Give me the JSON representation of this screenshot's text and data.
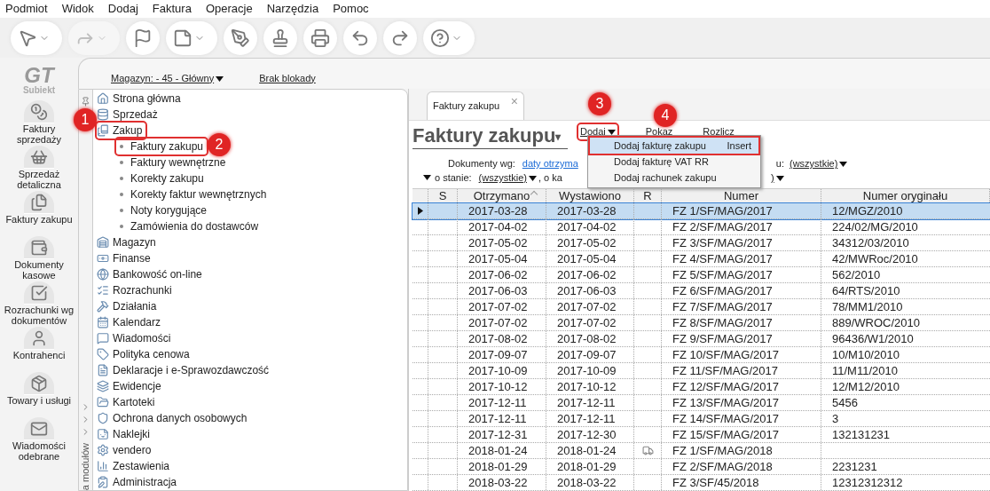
{
  "menu_bar": [
    "Podmiot",
    "Widok",
    "Dodaj",
    "Faktura",
    "Operacje",
    "Narzędzia",
    "Pomoc"
  ],
  "toolbar": [
    {
      "dropdown": true,
      "disabled": false
    },
    {
      "dropdown": true,
      "disabled": true
    },
    {
      "dropdown": false,
      "disabled": false
    },
    {
      "dropdown": true,
      "disabled": false
    },
    {
      "dropdown": false,
      "disabled": false
    },
    {
      "dropdown": false,
      "disabled": false
    },
    {
      "dropdown": false,
      "disabled": false
    },
    {
      "dropdown": false,
      "disabled": false
    },
    {
      "dropdown": false,
      "disabled": false
    },
    {
      "dropdown": true,
      "disabled": false
    }
  ],
  "logo": {
    "mark": "GT",
    "name": "Subiekt"
  },
  "rail": [
    "Faktury sprzedaży",
    "Sprzedaż detaliczna",
    "Faktury zakupu",
    "Dokumenty kasowe",
    "Rozrachunki wg dokumentów",
    "Kontrahenci",
    "Towary i usługi",
    "Wiadomości odebrane"
  ],
  "top_links": [
    {
      "text": "Magazyn: - 45 - Główny",
      "dropdown": true
    },
    {
      "text": "Brak blokady",
      "dropdown": false
    }
  ],
  "nav_tree": [
    {
      "label": "Strona główna",
      "highlighted": false
    },
    {
      "label": "Sprzedaż",
      "highlighted": false
    },
    {
      "label": "Zakup",
      "highlighted": true,
      "children": [
        {
          "label": "Faktury zakupu",
          "highlighted": true
        },
        {
          "label": "Faktury wewnętrzne",
          "highlighted": false
        },
        {
          "label": "Korekty zakupu",
          "highlighted": false
        },
        {
          "label": "Korekty faktur wewnętrznych",
          "highlighted": false
        },
        {
          "label": "Noty korygujące",
          "highlighted": false
        },
        {
          "label": "Zamówienia do dostawców",
          "highlighted": false
        }
      ]
    },
    {
      "label": "Magazyn",
      "highlighted": false
    },
    {
      "label": "Finanse",
      "highlighted": false
    },
    {
      "label": "Bankowość on-line",
      "highlighted": false
    },
    {
      "label": "Rozrachunki",
      "highlighted": false
    },
    {
      "label": "Działania",
      "highlighted": false
    },
    {
      "label": "Kalendarz",
      "highlighted": false
    },
    {
      "label": "Wiadomości",
      "highlighted": false
    },
    {
      "label": "Polityka cenowa",
      "highlighted": false
    },
    {
      "label": "Deklaracje i e-Sprawozdawczość",
      "highlighted": false
    },
    {
      "label": "Ewidencje",
      "highlighted": false
    },
    {
      "label": "Kartoteki",
      "highlighted": false
    },
    {
      "label": "Ochrona danych osobowych",
      "highlighted": false
    },
    {
      "label": "Naklejki",
      "highlighted": false
    },
    {
      "label": "vendero",
      "highlighted": false
    },
    {
      "label": "Zestawienia",
      "highlighted": false
    },
    {
      "label": "Administracja",
      "highlighted": false
    }
  ],
  "nav_side_label": "a modułów",
  "tab": {
    "label": "Faktury zakupu",
    "close": "×"
  },
  "page_title": "Faktury zakupu",
  "page_title_caret": "▾",
  "actions": [
    {
      "text": "Dodaj",
      "dropdown": true,
      "highlighted": true
    },
    {
      "text": "Pokaz",
      "dropdown": false,
      "highlighted": false
    },
    {
      "text": "Rozlicz",
      "dropdown": false,
      "highlighted": false
    }
  ],
  "filters": {
    "row1_label": "Dokumenty wg:",
    "row1_link": "daty otrzyma",
    "row1_tail_label": "u:",
    "row1_tail_value": "(wszystkie)",
    "row2_label": "o stanie:",
    "row2_value": "(wszystkie)",
    "row2_mid": ", o ka",
    "row2_tail": ")"
  },
  "dropdown_menu": [
    {
      "label": "Dodaj fakturę zakupu",
      "shortcut": "Insert",
      "selected": true,
      "highlighted": true
    },
    {
      "label": "Dodaj fakturę VAT RR",
      "selected": false,
      "highlighted": false
    },
    {
      "label": "Dodaj rachunek zakupu",
      "selected": false,
      "highlighted": false
    }
  ],
  "table": {
    "columns": [
      {
        "label": "S",
        "sorted": false
      },
      {
        "label": "Otrzymano",
        "sorted": true
      },
      {
        "label": "Wystawiono",
        "sorted": false
      },
      {
        "label": "R",
        "sorted": false
      },
      {
        "label": "Numer",
        "sorted": false
      },
      {
        "label": "Numer oryginału",
        "sorted": false
      }
    ],
    "rows": [
      {
        "received": "2017-03-28",
        "issued": "2017-03-28",
        "r_icon": false,
        "number": "FZ 1/SF/MAG/2017",
        "original": "12/MGZ/2010",
        "selected": true
      },
      {
        "received": "2017-04-02",
        "issued": "2017-04-02",
        "r_icon": false,
        "number": "FZ 2/SF/MAG/2017",
        "original": "224/02/MG/2010",
        "selected": false
      },
      {
        "received": "2017-05-02",
        "issued": "2017-05-02",
        "r_icon": false,
        "number": "FZ 3/SF/MAG/2017",
        "original": "34312/03/2010",
        "selected": false
      },
      {
        "received": "2017-05-04",
        "issued": "2017-05-04",
        "r_icon": false,
        "number": "FZ 4/SF/MAG/2017",
        "original": "42/MWRoc/2010",
        "selected": false
      },
      {
        "received": "2017-06-02",
        "issued": "2017-06-02",
        "r_icon": false,
        "number": "FZ 5/SF/MAG/2017",
        "original": "562/2010",
        "selected": false
      },
      {
        "received": "2017-06-03",
        "issued": "2017-06-03",
        "r_icon": false,
        "number": "FZ 6/SF/MAG/2017",
        "original": "64/RTS/2010",
        "selected": false
      },
      {
        "received": "2017-07-02",
        "issued": "2017-07-02",
        "r_icon": false,
        "number": "FZ 7/SF/MAG/2017",
        "original": "78/MM1/2010",
        "selected": false
      },
      {
        "received": "2017-07-02",
        "issued": "2017-07-02",
        "r_icon": false,
        "number": "FZ 8/SF/MAG/2017",
        "original": "889/WROC/2010",
        "selected": false
      },
      {
        "received": "2017-08-02",
        "issued": "2017-08-02",
        "r_icon": false,
        "number": "FZ 9/SF/MAG/2017",
        "original": "96436/W1/2010",
        "selected": false
      },
      {
        "received": "2017-09-07",
        "issued": "2017-09-07",
        "r_icon": false,
        "number": "FZ 10/SF/MAG/2017",
        "original": "10/M10/2010",
        "selected": false
      },
      {
        "received": "2017-10-09",
        "issued": "2017-10-09",
        "r_icon": false,
        "number": "FZ 11/SF/MAG/2017",
        "original": "11/M11/2010",
        "selected": false
      },
      {
        "received": "2017-10-12",
        "issued": "2017-10-12",
        "r_icon": false,
        "number": "FZ 12/SF/MAG/2017",
        "original": "12/M12/2010",
        "selected": false
      },
      {
        "received": "2017-12-11",
        "issued": "2017-12-11",
        "r_icon": false,
        "number": "FZ 13/SF/MAG/2017",
        "original": "5456",
        "selected": false
      },
      {
        "received": "2017-12-11",
        "issued": "2017-12-11",
        "r_icon": false,
        "number": "FZ 14/SF/MAG/2017",
        "original": "3",
        "selected": false
      },
      {
        "received": "2017-12-31",
        "issued": "2017-12-30",
        "r_icon": false,
        "number": "FZ 15/SF/MAG/2017",
        "original": "132131231",
        "selected": false
      },
      {
        "received": "2018-01-24",
        "issued": "2018-01-24",
        "r_icon": true,
        "number": "FZ 1/SF/MAG/2018",
        "original": "",
        "selected": false
      },
      {
        "received": "2018-01-29",
        "issued": "2018-01-29",
        "r_icon": false,
        "number": "FZ 2/SF/MAG/2018",
        "original": "2231231",
        "selected": false
      },
      {
        "received": "2018-03-22",
        "issued": "2018-03-22",
        "r_icon": false,
        "number": "FZ 3/SF/45/2018",
        "original": "12312312312",
        "selected": false
      }
    ]
  },
  "annotations": [
    "1",
    "2",
    "3",
    "4"
  ]
}
